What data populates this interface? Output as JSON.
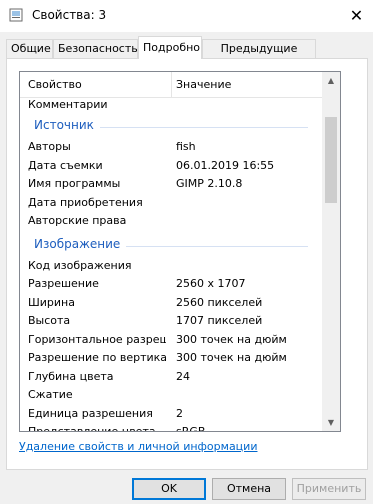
{
  "window": {
    "title": "Свойства: 3",
    "close_glyph": "✕"
  },
  "tabs": [
    {
      "label": "Общие"
    },
    {
      "label": "Безопасность"
    },
    {
      "label": "Подробно"
    },
    {
      "label": "Предыдущие версии"
    }
  ],
  "grid": {
    "col_property": "Свойство",
    "col_value": "Значение",
    "partial_top_row": "Комментарии",
    "groups": [
      {
        "title": "Источник",
        "rows": [
          {
            "k": "Авторы",
            "v": "fish"
          },
          {
            "k": "Дата съемки",
            "v": "06.01.2019 16:55"
          },
          {
            "k": "Имя программы",
            "v": "GIMP 2.10.8"
          },
          {
            "k": "Дата приобретения",
            "v": ""
          },
          {
            "k": "Авторские права",
            "v": ""
          }
        ]
      },
      {
        "title": "Изображение",
        "rows": [
          {
            "k": "Код изображения",
            "v": ""
          },
          {
            "k": "Разрешение",
            "v": "2560 x 1707"
          },
          {
            "k": "Ширина",
            "v": "2560 пикселей"
          },
          {
            "k": "Высота",
            "v": "1707 пикселей"
          },
          {
            "k": "Горизонтальное разреше...",
            "v": "300 точек на дюйм"
          },
          {
            "k": "Разрешение по вертикали",
            "v": "300 точек на дюйм"
          },
          {
            "k": "Глубина цвета",
            "v": "24"
          },
          {
            "k": "Сжатие",
            "v": ""
          },
          {
            "k": "Единица разрешения",
            "v": "2"
          },
          {
            "k": "Представление цвета",
            "v": "sRGB"
          }
        ]
      }
    ]
  },
  "remove_link": "Удаление свойств и личной информации",
  "buttons": {
    "ok": "OK",
    "cancel": "Отмена",
    "apply": "Применить"
  },
  "colors": {
    "group_title": "#1e5ebe",
    "link": "#0066cc",
    "focus_border": "#0078d7"
  }
}
